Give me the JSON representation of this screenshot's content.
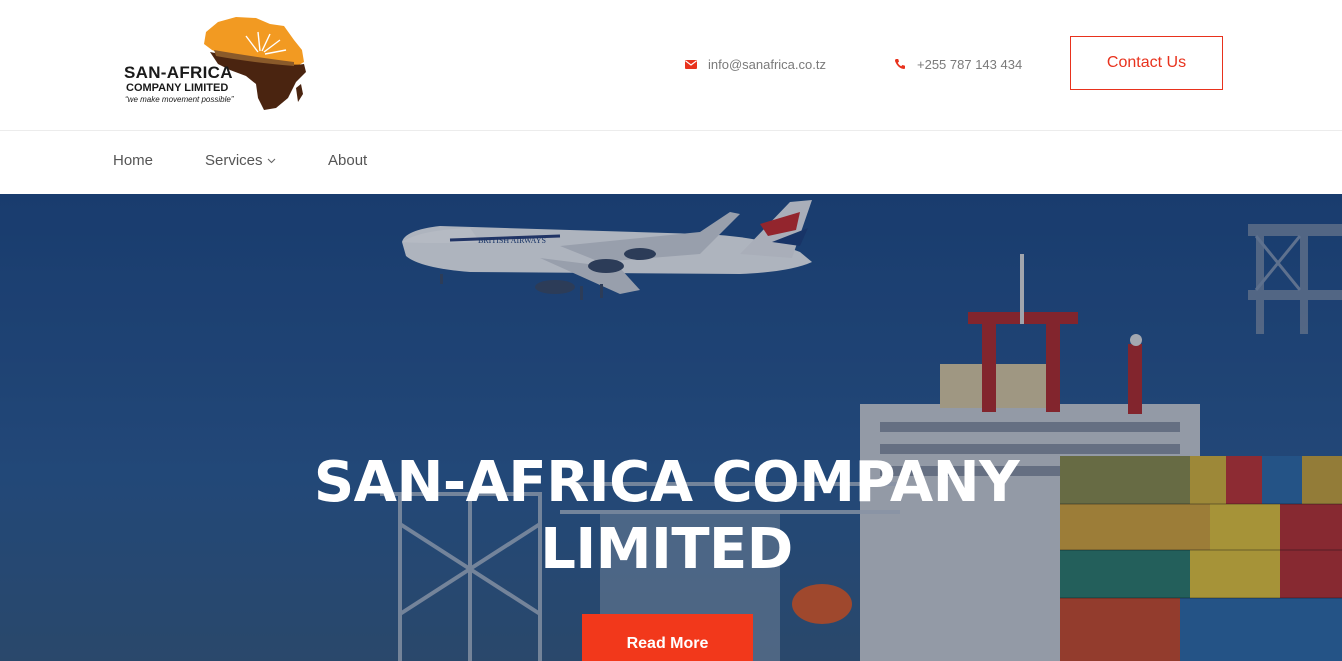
{
  "brand": {
    "name": "SAN-AFRICA",
    "sub": "COMPANY LIMITED",
    "tagline": "“we make movement possible”"
  },
  "contact": {
    "email": "info@sanafrica.co.tz",
    "phone": "+255 787 143 434",
    "button_label": "Contact Us"
  },
  "nav": {
    "items": [
      {
        "label": "Home"
      },
      {
        "label": "Services"
      },
      {
        "label": "About"
      }
    ]
  },
  "hero": {
    "title": "SAN-AFRICA COMPANY LIMITED",
    "button_label": "Read More",
    "plane_livery": "BRITISH AIRWAYS"
  },
  "colors": {
    "accent": "#e8321d",
    "logo_orange": "#f29a22",
    "logo_brown": "#4a2410"
  }
}
